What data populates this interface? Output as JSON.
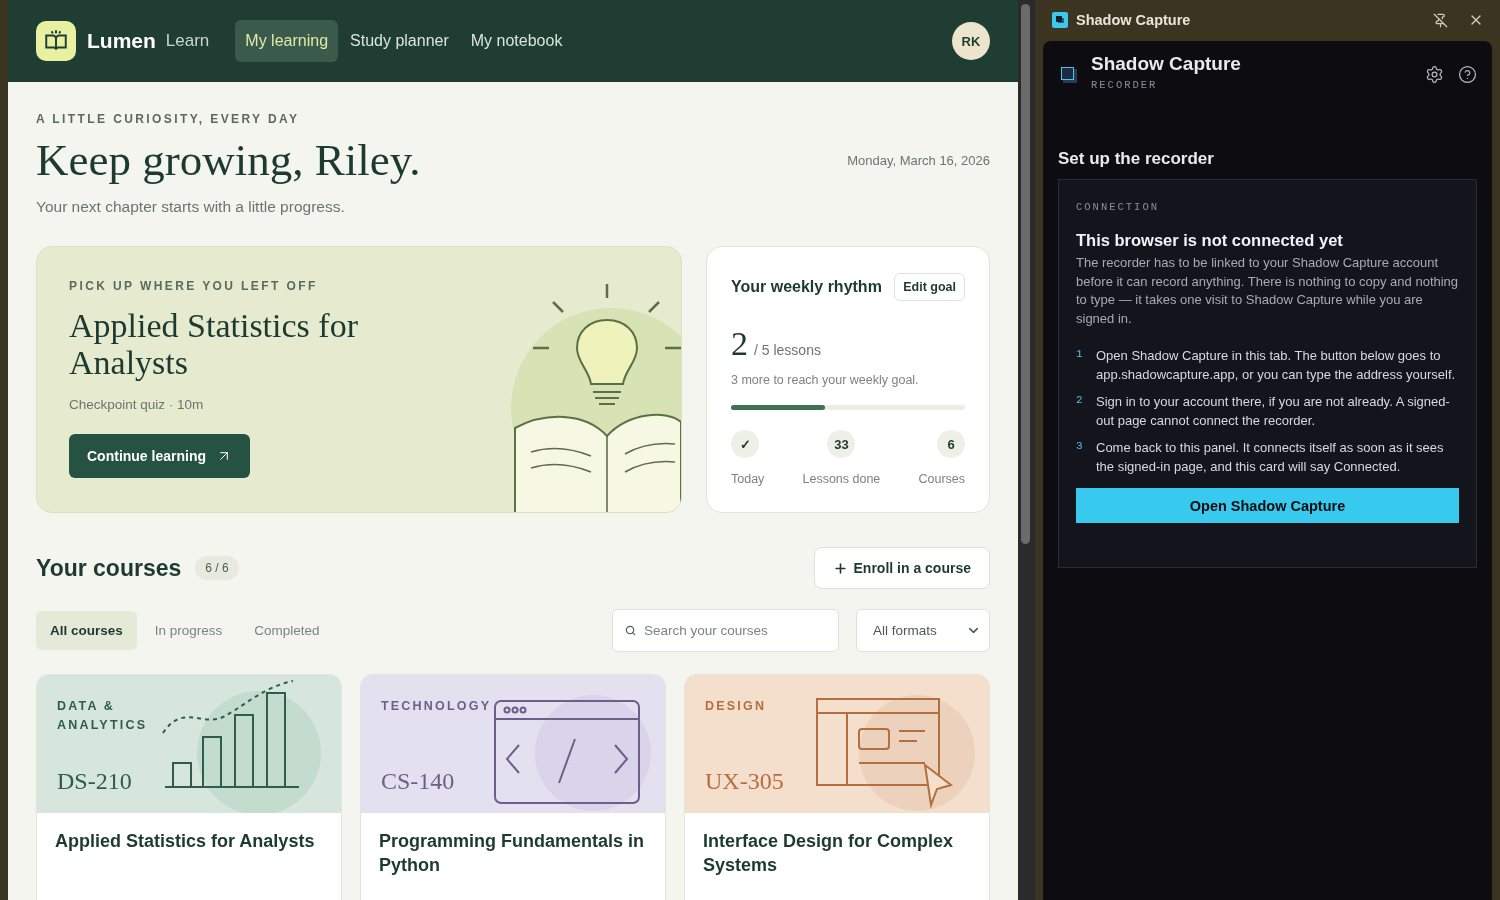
{
  "nav": {
    "brand": "Lumen",
    "product": "Learn",
    "avatar": "RK",
    "tabs": [
      {
        "label": "My learning",
        "selected": true
      },
      {
        "label": "Study planner",
        "selected": false
      },
      {
        "label": "My notebook",
        "selected": false
      }
    ]
  },
  "greeting": {
    "eyebrow": "A LITTLE CURIOSITY, EVERY DAY",
    "title": "Keep growing, Riley.",
    "subtitle": "Your next chapter starts with a little progress.",
    "date": "Monday, March 16, 2026"
  },
  "resume": {
    "eyebrow": "PICK UP WHERE YOU LEFT OFF",
    "title": "Applied Statistics for Analysts",
    "meta": "Checkpoint quiz · 10m",
    "button": "Continue learning"
  },
  "weekly": {
    "title": "Your weekly rhythm",
    "edit": "Edit goal",
    "count": "2",
    "unit": "/ 5 lessons",
    "note": "3 more to reach your weekly goal.",
    "level": 0.4,
    "stats": [
      {
        "value": "✓",
        "label": "Today"
      },
      {
        "value": "33",
        "label": "Lessons done"
      },
      {
        "value": "6",
        "label": "Courses"
      }
    ]
  },
  "courses": {
    "title": "Your courses",
    "count": "6 / 6",
    "enroll": "Enroll in a course",
    "filters": [
      {
        "label": "All courses",
        "selected": true
      },
      {
        "label": "In progress",
        "selected": false
      },
      {
        "label": "Completed",
        "selected": false
      }
    ],
    "search": {
      "placeholder": "Search your courses"
    },
    "format": "All formats",
    "cards": [
      {
        "kind": "chart",
        "category": "DATA & ANALYTICS",
        "code": "DS-210",
        "title": "Applied Statistics for Analysts",
        "color": "#d6e6dc"
      },
      {
        "kind": "code",
        "category": "TECHNOLOGY",
        "code": "CS-140",
        "title": "Programming Fundamentals in Python",
        "color": "#e3e0f0"
      },
      {
        "kind": "design",
        "category": "DESIGN",
        "code": "UX-305",
        "title": "Interface Design for Complex Systems",
        "color": "#f3dfcc"
      }
    ]
  },
  "panel": {
    "window_title": "Shadow Capture",
    "title": "Shadow Capture",
    "subtitle": "RECORDER",
    "section": "Set up the recorder",
    "card": {
      "label": "CONNECTION",
      "heading": "This browser is not connected yet",
      "body": "The recorder has to be linked to your Shadow Capture account before it can record anything. There is nothing to copy and nothing to type — it takes one visit to Shadow Capture while you are signed in.",
      "steps": [
        {
          "number": "1",
          "text": "Open Shadow Capture in this tab. The button below goes to app.shadowcapture.app, or you can type the address yourself."
        },
        {
          "number": "2",
          "text": "Sign in to your account there, if you are not already. A signed-out page cannot connect the recorder."
        },
        {
          "number": "3",
          "text": "Come back to this panel. It connects itself as soon as it sees the signed-in page, and this card will say Connected."
        }
      ],
      "button": "Open Shadow Capture"
    }
  }
}
